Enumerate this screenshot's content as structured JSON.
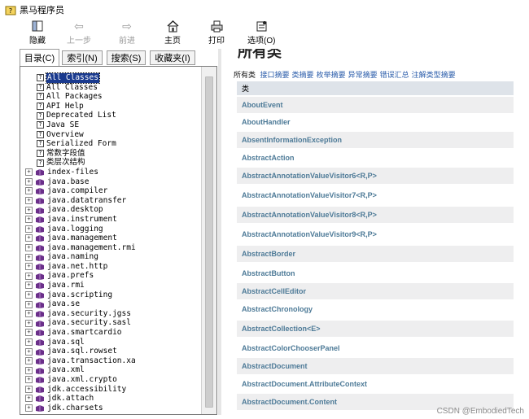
{
  "window": {
    "title": "黑马程序员"
  },
  "toolbar": {
    "items": [
      {
        "label": "隐藏",
        "icon": "hide-icon",
        "enabled": true
      },
      {
        "label": "上一步",
        "icon": "back-arrow-icon",
        "enabled": false
      },
      {
        "label": "前进",
        "icon": "forward-arrow-icon",
        "enabled": false
      },
      {
        "label": "主页",
        "icon": "home-icon",
        "enabled": true
      },
      {
        "label": "打印",
        "icon": "print-icon",
        "enabled": true
      },
      {
        "label": "选项(O)",
        "icon": "options-icon",
        "enabled": true
      }
    ]
  },
  "tabs": [
    {
      "label": "目录(C)",
      "active": true
    },
    {
      "label": "索引(N)",
      "active": false
    },
    {
      "label": "搜索(S)",
      "active": false
    },
    {
      "label": "收藏夹(I)",
      "active": false
    }
  ],
  "tree": {
    "help_items": [
      "All Classes",
      "All Classes",
      "All Packages",
      "API Help",
      "Deprecated List",
      "Java SE",
      "Overview",
      "Serialized Form",
      "常数字段值",
      "类层次结构"
    ],
    "selected_index": 0,
    "packages": [
      "index-files",
      "java.base",
      "java.compiler",
      "java.datatransfer",
      "java.desktop",
      "java.instrument",
      "java.logging",
      "java.management",
      "java.management.rmi",
      "java.naming",
      "java.net.http",
      "java.prefs",
      "java.rmi",
      "java.scripting",
      "java.se",
      "java.security.jgss",
      "java.security.sasl",
      "java.smartcardio",
      "java.sql",
      "java.sql.rowset",
      "java.transaction.xa",
      "java.xml",
      "java.xml.crypto",
      "jdk.accessibility",
      "jdk.attach",
      "jdk.charsets"
    ]
  },
  "content": {
    "heading": "所有类",
    "nav": {
      "current": "所有类",
      "links": [
        "接口摘要",
        "类摘要",
        "枚举摘要",
        "异常摘要",
        "错误汇总",
        "注解类型摘要"
      ]
    },
    "table_header": "类",
    "classes": [
      "AboutEvent",
      "AboutHandler",
      "AbsentInformationException",
      "AbstractAction",
      "AbstractAnnotationValueVisitor6<R,P>",
      "AbstractAnnotationValueVisitor7<R,P>",
      "AbstractAnnotationValueVisitor8<R,P>",
      "AbstractAnnotationValueVisitor9<R,P>",
      "AbstractBorder",
      "AbstractButton",
      "AbstractCellEditor",
      "AbstractChronology",
      "AbstractCollection<E>",
      "AbstractColorChooserPanel",
      "AbstractDocument",
      "AbstractDocument.AttributeContext",
      "AbstractDocument.Content"
    ]
  },
  "watermark": "CSDN @EmbodiedTech",
  "colors": {
    "selection": "#1a3a8e",
    "link": "#2a5caa",
    "class_link": "#4d7a97",
    "table_header_bg": "#dee3e9",
    "alt_row_bg": "#eeeeef",
    "package_icon": "#6b2f8a"
  }
}
